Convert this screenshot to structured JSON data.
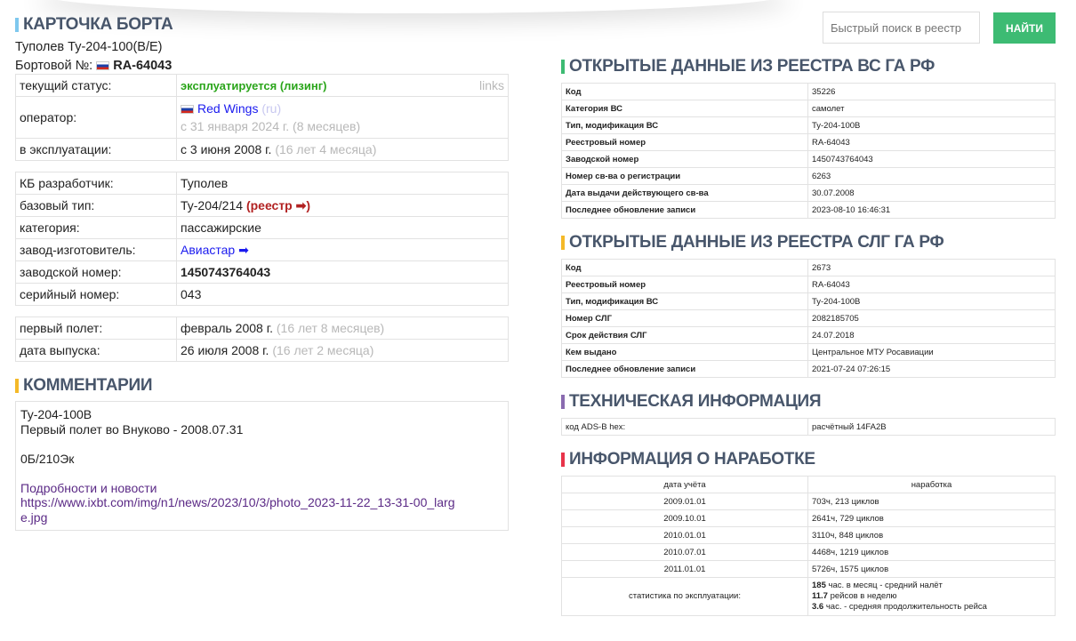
{
  "search": {
    "placeholder": "Быстрый поиск в реестр",
    "button": "НАЙТИ"
  },
  "card": {
    "title": "КАРТОЧКА БОРТА",
    "model": "Туполев Ту-204-100(B/E)",
    "reg_label": "Бортовой №:",
    "reg": "RA-64043",
    "status_label": "текущий статус:",
    "status": "эксплуатируется (лизинг)",
    "links": "links",
    "operator_label": "оператор:",
    "operator": "Red Wings",
    "operator_lang": "(ru)",
    "operator_since": "с 31 января 2024 г. (8 месяцев)",
    "service_label": "в эксплуатации:",
    "service": "с 3 июня 2008 г.",
    "service_dur": "(16 лет 4 месяца)",
    "kb_label": "КБ разработчик:",
    "kb": "Туполев",
    "base_label": "базовый тип:",
    "base": "Ту-204/214",
    "base_link": "(реестр ➡)",
    "cat_label": "категория:",
    "cat": "пассажирские",
    "plant_label": "завод-изготовитель:",
    "plant": "Авиастар ➡",
    "msn_label": "заводской номер:",
    "msn": "1450743764043",
    "serial_label": "серийный номер:",
    "serial": "043",
    "ff_label": "первый полет:",
    "ff": "февраль 2008 г.",
    "ff_dur": "(16 лет 8 месяцев)",
    "rel_label": "дата выпуска:",
    "rel": "26 июля 2008 г.",
    "rel_dur": "(16 лет 2 месяца)"
  },
  "comments": {
    "title": "КОММЕНТАРИИ",
    "line1": "Ту-204-100В",
    "line2": "Первый полет во Внуково - 2008.07.31",
    "line3": "0Б/210Эк",
    "link_title": "Подробности и новости",
    "link_url": "https://www.ixbt.com/img/n1/news/2023/10/3/photo_2023-11-22_13-31-00_large.jpg"
  },
  "reg_vs": {
    "title": "ОТКРЫТЫЕ ДАННЫЕ ИЗ РЕЕСТРА ВС ГА РФ",
    "color": "#3dbb73",
    "rows": [
      [
        "Код",
        "35226"
      ],
      [
        "Категория ВС",
        "самолет"
      ],
      [
        "Тип, модификация ВС",
        "Ту-204-100В"
      ],
      [
        "Реестровый номер",
        "RA-64043"
      ],
      [
        "Заводской номер",
        "1450743764043"
      ],
      [
        "Номер св-ва о регистрации",
        "6263"
      ],
      [
        "Дата выдачи действующего св-ва",
        "30.07.2008"
      ],
      [
        "Последнее обновление записи",
        "2023-08-10 16:46:31"
      ]
    ]
  },
  "reg_slg": {
    "title": "ОТКРЫТЫЕ ДАННЫЕ ИЗ РЕЕСТРА СЛГ ГА РФ",
    "color": "#f4b928",
    "rows": [
      [
        "Код",
        "2673"
      ],
      [
        "Реестровый номер",
        "RA-64043"
      ],
      [
        "Тип, модификация ВС",
        "Ту-204-100В"
      ],
      [
        "Номер СЛГ",
        "2082185705"
      ],
      [
        "Срок действия СЛГ",
        "24.07.2018"
      ],
      [
        "Кем выдано",
        "Центральное МТУ Росавиации"
      ],
      [
        "Последнее обновление записи",
        "2021-07-24 07:26:15"
      ]
    ]
  },
  "tech": {
    "title": "ТЕХНИЧЕСКАЯ ИНФОРМАЦИЯ",
    "color": "#8a6bb0",
    "rows": [
      [
        "код ADS-B hex:",
        "расчётный 14FA2B"
      ]
    ]
  },
  "hours": {
    "title": "ИНФОРМАЦИЯ О НАРАБОТКЕ",
    "color": "#e8334a",
    "head": [
      "дата учёта",
      "наработка"
    ],
    "rows": [
      [
        "2009.01.01",
        "703ч, 213 циклов"
      ],
      [
        "2009.10.01",
        "2641ч, 729 циклов"
      ],
      [
        "2010.01.01",
        "3110ч, 848 циклов"
      ],
      [
        "2010.07.01",
        "4468ч, 1219 циклов"
      ],
      [
        "2011.01.01",
        "5726ч, 1575 циклов"
      ]
    ],
    "stats_label": "статистика по эксплуатации:",
    "stats": [
      [
        "185",
        "час. в месяц - средний налёт"
      ],
      [
        "11.7",
        "рейсов в неделю"
      ],
      [
        "3.6",
        "час. - средняя продолжительность рейса"
      ]
    ]
  }
}
